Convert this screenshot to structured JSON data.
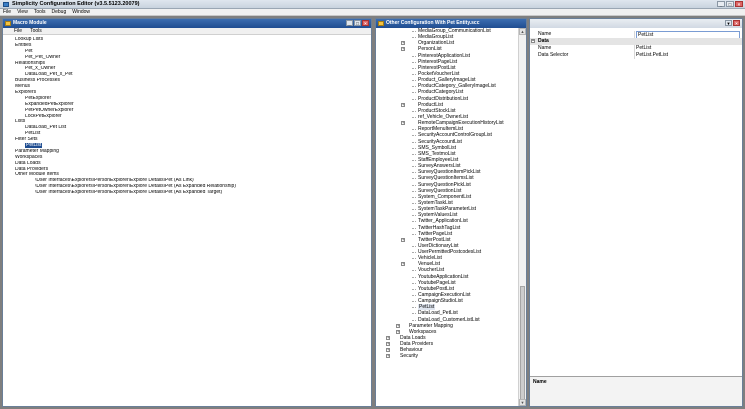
{
  "app": {
    "title": "Simplicity Configuration Editor (v3.5.5123.20079)",
    "menu": [
      "File",
      "View",
      "Tools",
      "Debug",
      "Window"
    ]
  },
  "window_buttons": {
    "minimize": "_",
    "maximize": "□",
    "close": "×"
  },
  "macro_panel": {
    "title": "Macro Module",
    "menu": [
      "File",
      "Tools"
    ],
    "tree": [
      {
        "label": "Lookup Lists",
        "level": 1
      },
      {
        "label": "Entities",
        "level": 1
      },
      {
        "label": "Pet",
        "level": 2
      },
      {
        "label": "Pet_Pet_Owner",
        "level": 2
      },
      {
        "label": "Relationships",
        "level": 1
      },
      {
        "label": "Pet_x_Owner",
        "level": 2
      },
      {
        "label": "DataLoad_Pet_x_Pet",
        "level": 2
      },
      {
        "label": "Business Processes",
        "level": 1
      },
      {
        "label": "Menus",
        "level": 1
      },
      {
        "label": "Explorers",
        "level": 1
      },
      {
        "label": "PetExplorer",
        "level": 2
      },
      {
        "label": "ExpandedPetExplorer",
        "level": 2
      },
      {
        "label": "PetPetOwnerExplorer",
        "level": 2
      },
      {
        "label": "LockPetExplorer",
        "level": 2
      },
      {
        "label": "Lists",
        "level": 1
      },
      {
        "label": "DataLoad_Pet List",
        "level": 2
      },
      {
        "label": "PetList",
        "level": 2
      },
      {
        "label": "Filter Sets",
        "level": 1
      },
      {
        "label": "PetList",
        "level": 2,
        "selected": true
      },
      {
        "label": "Parameter Mapping",
        "level": 1
      },
      {
        "label": "Workspaces",
        "level": 1
      },
      {
        "label": "Data Loads",
        "level": 1
      },
      {
        "label": "Data Providers",
        "level": 1
      },
      {
        "label": "Other Module Items",
        "level": 1
      },
      {
        "label": "\\User Interfaces\\Explorers\\PersonExplorer\\Explore Details\\Pet (As Link)",
        "level": 3
      },
      {
        "label": "\\User Interfaces\\Explorers\\PersonExplorer\\Explore Details\\Pet (As Expanded Relationship)",
        "level": 3
      },
      {
        "label": "\\User Interfaces\\Explorers\\PersonExplorer\\Explore Details\\Pet (As Expanded Target)",
        "level": 3
      }
    ]
  },
  "other_panel": {
    "title": "Other Configuration With Pet Entity.scc",
    "tree": [
      {
        "label": "MediaGroup_CommunicationList",
        "level": 4
      },
      {
        "label": "MediaGroupList",
        "level": 4
      },
      {
        "label": "OrganizationList",
        "level": 4,
        "expander": "+"
      },
      {
        "label": "PersonList",
        "level": 4,
        "expander": "+"
      },
      {
        "label": "PinterestApplicationList",
        "level": 4
      },
      {
        "label": "PinterestPageList",
        "level": 4
      },
      {
        "label": "PinterestPostList",
        "level": 4
      },
      {
        "label": "PocketVoucherList",
        "level": 4
      },
      {
        "label": "Product_GalleryImageList",
        "level": 4
      },
      {
        "label": "ProductCategory_GalleryImageList",
        "level": 4
      },
      {
        "label": "ProductCategoryList",
        "level": 4
      },
      {
        "label": "ProductDistributionList",
        "level": 4
      },
      {
        "label": "ProductList",
        "level": 4,
        "expander": "+"
      },
      {
        "label": "ProductStockList",
        "level": 4
      },
      {
        "label": "ref_Vehicle_OwnerList",
        "level": 4
      },
      {
        "label": "RemoteCampaignExecutionHistoryList",
        "level": 4,
        "expander": "+"
      },
      {
        "label": "ReportMenuItemList",
        "level": 4
      },
      {
        "label": "SecurityAccountControlGroupList",
        "level": 4
      },
      {
        "label": "SecurityAccountList",
        "level": 4
      },
      {
        "label": "SMS_SymbolList",
        "level": 4
      },
      {
        "label": "SMS_TextmoList",
        "level": 4
      },
      {
        "label": "StaffEmployeeList",
        "level": 4
      },
      {
        "label": "SurveyAnswersList",
        "level": 4
      },
      {
        "label": "SurveyQuestionItemPickList",
        "level": 4
      },
      {
        "label": "SurveyQuestionItemsList",
        "level": 4
      },
      {
        "label": "SurveyQuestionPickList",
        "level": 4
      },
      {
        "label": "SurveyQuestionList",
        "level": 4
      },
      {
        "label": "System_ComponentList",
        "level": 4
      },
      {
        "label": "SystemTaskList",
        "level": 4
      },
      {
        "label": "SystemTaskParameterList",
        "level": 4
      },
      {
        "label": "SystemValuesList",
        "level": 4
      },
      {
        "label": "Twitter_ApplicationList",
        "level": 4
      },
      {
        "label": "TwitterHashTagList",
        "level": 4
      },
      {
        "label": "TwitterPageList",
        "level": 4
      },
      {
        "label": "TwitterPostList",
        "level": 4,
        "expander": "+"
      },
      {
        "label": "UserDictionaryList",
        "level": 4
      },
      {
        "label": "UserPermittedPostcodesList",
        "level": 4
      },
      {
        "label": "VehicleList",
        "level": 4
      },
      {
        "label": "VenueList",
        "level": 4,
        "expander": "+"
      },
      {
        "label": "VoucherList",
        "level": 4
      },
      {
        "label": "YoutubeApplicationList",
        "level": 4
      },
      {
        "label": "YoutubePageList",
        "level": 4
      },
      {
        "label": "YoutubePostList",
        "level": 4
      },
      {
        "label": "CampaignExecutionList",
        "level": 4
      },
      {
        "label": "CampaignStudioList",
        "level": 4
      },
      {
        "label": "PetList",
        "level": 4,
        "highlight": true
      },
      {
        "label": "DataLoad_PetList",
        "level": 4
      },
      {
        "label": "DataLoad_CustomerListList",
        "level": 4
      },
      {
        "label": "Parameter Mapping",
        "level": 2,
        "expander": "+"
      },
      {
        "label": "Workspaces",
        "level": 2,
        "expander": "+"
      },
      {
        "label": "Data Loads",
        "level": 1,
        "expander": "+"
      },
      {
        "label": "Data Providers",
        "level": 1,
        "expander": "+"
      },
      {
        "label": "Behaviour",
        "level": 1,
        "expander": "+"
      },
      {
        "label": "Security",
        "level": 1,
        "expander": "+"
      }
    ]
  },
  "properties": {
    "rows": [
      {
        "type": "row",
        "key": "Name",
        "value": "PetList",
        "editing": true
      },
      {
        "type": "category",
        "key": "Data"
      },
      {
        "type": "row",
        "key": "Name",
        "value": "PetList"
      },
      {
        "type": "row",
        "key": "Data Selector",
        "value": "PetList.PetList"
      }
    ],
    "description_title": "Name"
  }
}
